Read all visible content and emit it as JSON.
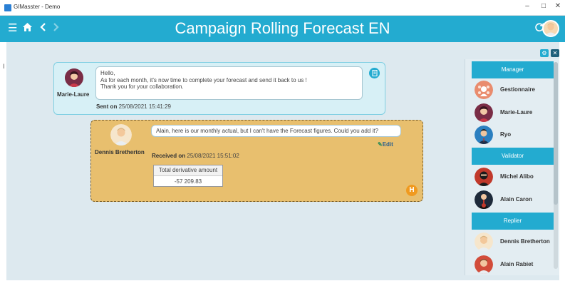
{
  "window": {
    "app_title": "GIMasster - Demo",
    "minimize": "–",
    "maximize": "□",
    "close": "✕"
  },
  "header": {
    "title": "Campaign Rolling Forecast EN"
  },
  "message_sent": {
    "author": "Marie-Laure",
    "text": "Hello,\nAs for each month, it's now time to complete your forecast and send it back to us !\nThank you for your collaboration.",
    "meta_label": "Sent on",
    "meta_value": "25/08/2021 15:41:29"
  },
  "message_received": {
    "author": "Dennis Bretherton",
    "text": "Alain, here is our monthly actual, but I can't have the Forecast figures. Could you add it?",
    "edit_label": "Edit",
    "meta_label": "Received on",
    "meta_value": "25/08/2021 15:51:02",
    "table": {
      "header": "Total derivative amount",
      "value": "-57 209.83"
    }
  },
  "panel": {
    "sections": [
      {
        "title": "Manager",
        "people": [
          {
            "name": "Gestionnaire",
            "icon": "group-avatar-icon",
            "color": "#e98c6e"
          },
          {
            "name": "Marie-Laure",
            "icon": "woman-avatar-icon",
            "color": "#7a2d46"
          },
          {
            "name": "Ryo",
            "icon": "man-avatar-icon",
            "color": "#2b7fc0"
          }
        ]
      },
      {
        "title": "Validator",
        "people": [
          {
            "name": "Michel Alibo",
            "icon": "ninja-avatar-icon",
            "color": "#c1392b"
          },
          {
            "name": "Alain Caron",
            "icon": "guitar-avatar-icon",
            "color": "#1e2a3a"
          }
        ]
      },
      {
        "title": "Replier",
        "people": [
          {
            "name": "Dennis Bretherton",
            "icon": "man-avatar-icon",
            "color": "#f3d2a8"
          },
          {
            "name": "Alain Rabiet",
            "icon": "man-avatar-icon",
            "color": "#d24c3a"
          }
        ]
      }
    ]
  },
  "colors": {
    "accent": "#23abd0",
    "received_bg": "#e8bf6e",
    "sent_bg": "#d7f0f6",
    "help": "#f09a1f"
  }
}
